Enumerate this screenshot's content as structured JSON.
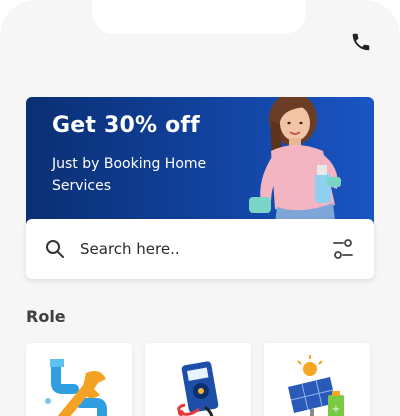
{
  "header": {
    "phone_icon": "phone-icon"
  },
  "banner": {
    "title": "Get 30% off",
    "subtitle": "Just by Booking Home Services"
  },
  "search": {
    "placeholder": "Search here..",
    "search_icon": "search-icon",
    "filter_icon": "filter-sliders-icon"
  },
  "roles": {
    "title": "Role",
    "items": [
      {
        "icon": "plumbing-wrench-icon"
      },
      {
        "icon": "multimeter-icon"
      },
      {
        "icon": "solar-panel-icon"
      }
    ]
  },
  "colors": {
    "banner_dark": "#0a2f73",
    "banner_light": "#1a55c4",
    "background": "#f6f6f6",
    "text_dark": "#3f3f3f"
  }
}
